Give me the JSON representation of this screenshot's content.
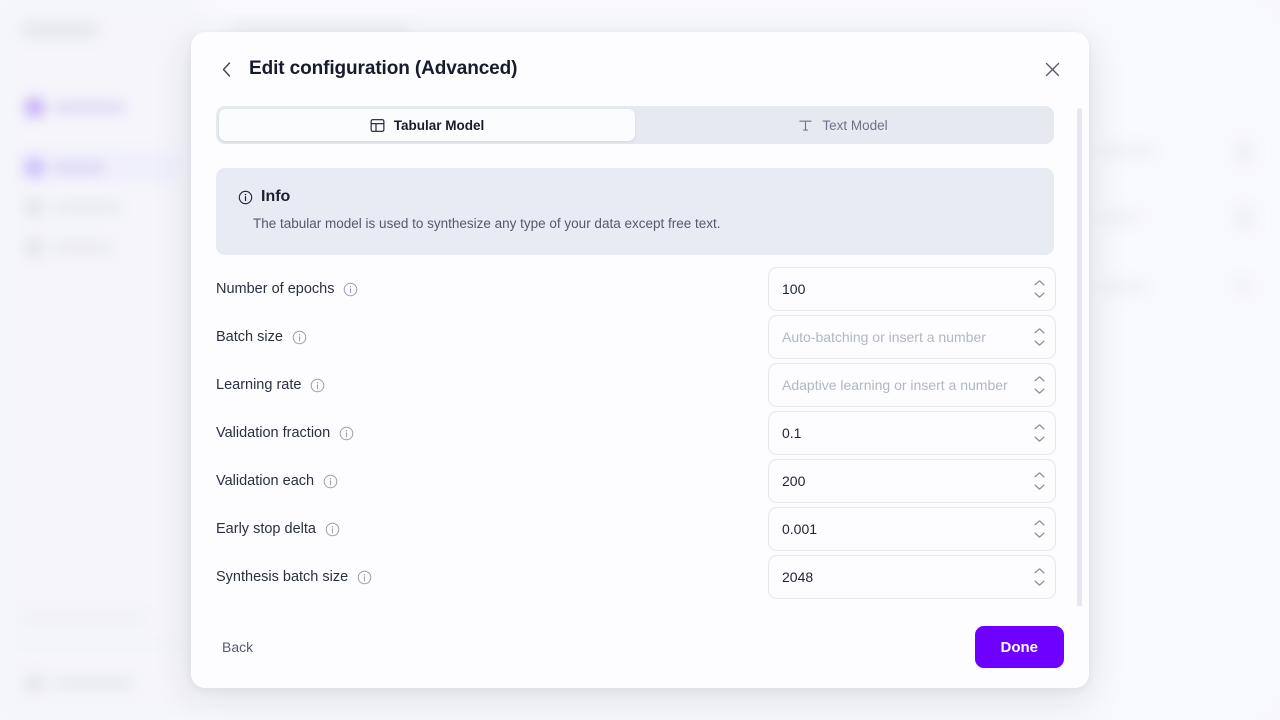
{
  "modal": {
    "title": "Edit configuration (Advanced)",
    "back_icon": "chevron-left-icon",
    "close_icon": "close-icon"
  },
  "tabs": [
    {
      "label": "Tabular Model",
      "icon": "table-icon",
      "active": true
    },
    {
      "label": "Text Model",
      "icon": "text-type-icon",
      "active": false
    }
  ],
  "info": {
    "icon": "info-circle-icon",
    "heading": "Info",
    "body": "The tabular model is used to synthesize any type of your data except free text."
  },
  "fields": [
    {
      "label": "Number of epochs",
      "value": "100",
      "placeholder": ""
    },
    {
      "label": "Batch size",
      "value": "",
      "placeholder": "Auto-batching or insert a number"
    },
    {
      "label": "Learning rate",
      "value": "",
      "placeholder": "Adaptive learning or insert a number"
    },
    {
      "label": "Validation fraction",
      "value": "0.1",
      "placeholder": ""
    },
    {
      "label": "Validation each",
      "value": "200",
      "placeholder": ""
    },
    {
      "label": "Early stop delta",
      "value": "0.001",
      "placeholder": ""
    },
    {
      "label": "Synthesis batch size",
      "value": "2048",
      "placeholder": ""
    }
  ],
  "footer": {
    "back_label": "Back",
    "done_label": "Done"
  },
  "colors": {
    "accent": "#6E00FF",
    "info_banner_bg": "#E7EBF3",
    "tab_track_bg": "#E6E9EF",
    "modal_bg": "#FDFDFF",
    "page_bg": "#F7F8FB"
  }
}
